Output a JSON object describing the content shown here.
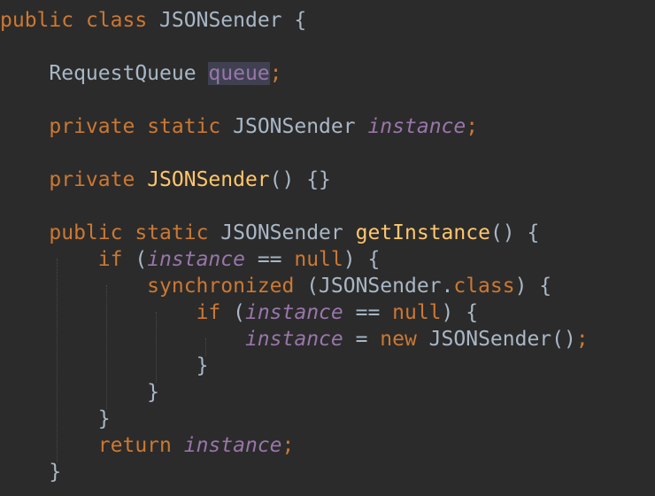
{
  "editor": {
    "colors": {
      "background": "#2b2b2b",
      "keyword": "#cc7832",
      "field": "#9876aa",
      "method": "#ffc66d",
      "default": "#a9b7c6",
      "usage_highlight": "#3f4150"
    },
    "lines": [
      {
        "indent": "",
        "tokens": [
          {
            "t": "public",
            "c": "kw"
          },
          {
            "t": " ",
            "c": "plain"
          },
          {
            "t": "class",
            "c": "kw"
          },
          {
            "t": " JSONSender {",
            "c": "plain"
          }
        ]
      },
      {
        "indent": "",
        "tokens": []
      },
      {
        "indent": "    ",
        "tokens": [
          {
            "t": "RequestQueue ",
            "c": "plain"
          },
          {
            "t": "queue",
            "c": "hl"
          },
          {
            "t": ";",
            "c": "kw"
          }
        ]
      },
      {
        "indent": "",
        "tokens": []
      },
      {
        "indent": "    ",
        "tokens": [
          {
            "t": "private",
            "c": "kw"
          },
          {
            "t": " ",
            "c": "plain"
          },
          {
            "t": "static",
            "c": "kw"
          },
          {
            "t": " JSONSender ",
            "c": "plain"
          },
          {
            "t": "instance",
            "c": "field-i"
          },
          {
            "t": ";",
            "c": "kw"
          }
        ]
      },
      {
        "indent": "",
        "tokens": []
      },
      {
        "indent": "    ",
        "tokens": [
          {
            "t": "private",
            "c": "kw"
          },
          {
            "t": " ",
            "c": "plain"
          },
          {
            "t": "JSONSender",
            "c": "method"
          },
          {
            "t": "() {}",
            "c": "plain"
          }
        ]
      },
      {
        "indent": "",
        "tokens": []
      },
      {
        "indent": "    ",
        "tokens": [
          {
            "t": "public",
            "c": "kw"
          },
          {
            "t": " ",
            "c": "plain"
          },
          {
            "t": "static",
            "c": "kw"
          },
          {
            "t": " JSONSender ",
            "c": "plain"
          },
          {
            "t": "getInstance",
            "c": "method"
          },
          {
            "t": "() {",
            "c": "plain"
          }
        ]
      },
      {
        "indent": "        ",
        "tokens": [
          {
            "t": "if",
            "c": "kw"
          },
          {
            "t": " (",
            "c": "plain"
          },
          {
            "t": "instance",
            "c": "field-i"
          },
          {
            "t": " == ",
            "c": "plain"
          },
          {
            "t": "null",
            "c": "kw"
          },
          {
            "t": ") {",
            "c": "plain"
          }
        ]
      },
      {
        "indent": "            ",
        "tokens": [
          {
            "t": "synchronized",
            "c": "kw"
          },
          {
            "t": " (JSONSender.",
            "c": "plain"
          },
          {
            "t": "class",
            "c": "kw"
          },
          {
            "t": ") {",
            "c": "plain"
          }
        ]
      },
      {
        "indent": "                ",
        "tokens": [
          {
            "t": "if",
            "c": "kw"
          },
          {
            "t": " (",
            "c": "plain"
          },
          {
            "t": "instance",
            "c": "field-i"
          },
          {
            "t": " == ",
            "c": "plain"
          },
          {
            "t": "null",
            "c": "kw"
          },
          {
            "t": ") {",
            "c": "plain"
          }
        ]
      },
      {
        "indent": "                    ",
        "tokens": [
          {
            "t": "instance",
            "c": "field-i"
          },
          {
            "t": " = ",
            "c": "plain"
          },
          {
            "t": "new",
            "c": "kw"
          },
          {
            "t": " JSONSender()",
            "c": "plain"
          },
          {
            "t": ";",
            "c": "kw"
          }
        ]
      },
      {
        "indent": "                ",
        "tokens": [
          {
            "t": "}",
            "c": "plain"
          }
        ]
      },
      {
        "indent": "            ",
        "tokens": [
          {
            "t": "}",
            "c": "plain"
          }
        ]
      },
      {
        "indent": "        ",
        "tokens": [
          {
            "t": "}",
            "c": "plain"
          }
        ]
      },
      {
        "indent": "        ",
        "tokens": [
          {
            "t": "return",
            "c": "kw"
          },
          {
            "t": " ",
            "c": "plain"
          },
          {
            "t": "instance",
            "c": "field-i"
          },
          {
            "t": ";",
            "c": "kw"
          }
        ]
      },
      {
        "indent": "    ",
        "tokens": [
          {
            "t": "}",
            "c": "plain"
          }
        ]
      }
    ]
  }
}
